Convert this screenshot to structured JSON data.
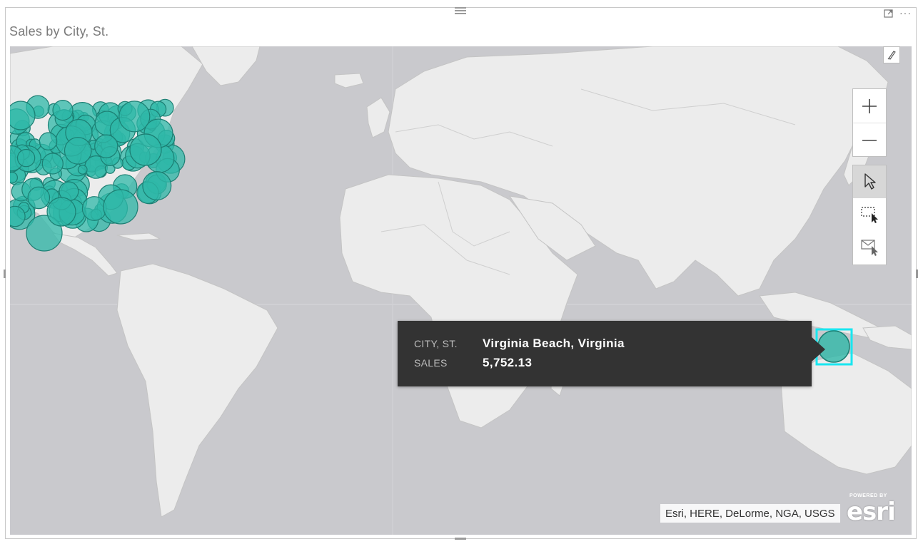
{
  "visual": {
    "title": "Sales by City, St."
  },
  "header": {
    "focus_mode_icon": "focus-mode-icon",
    "more_options_icon": "ellipsis-icon",
    "more_options_label": "···"
  },
  "map_controls": {
    "paint_icon": "paintbrush-icon",
    "zoom_in_icon": "plus-icon",
    "zoom_out_icon": "minus-icon",
    "select_icon": "cursor-arrow-icon",
    "rect_select_icon": "rectangle-select-icon",
    "lasso_select_icon": "lasso-select-icon"
  },
  "tooltip": {
    "field1_label": "CITY, ST.",
    "field1_value": "Virginia Beach, Virginia",
    "field2_label": "SALES",
    "field2_value": "5,752.13"
  },
  "attribution": {
    "text": "Esri, HERE, DeLorme, NGA, USGS",
    "logo_powered": "POWERED BY",
    "logo_text": "esri"
  },
  "colors": {
    "bubble_fill": "#2fb8a8",
    "bubble_stroke": "#1c7f73",
    "land": "#ececec",
    "water": "#c9c9cd",
    "highlight": "#19e6f0",
    "tooltip_bg": "#333333"
  }
}
